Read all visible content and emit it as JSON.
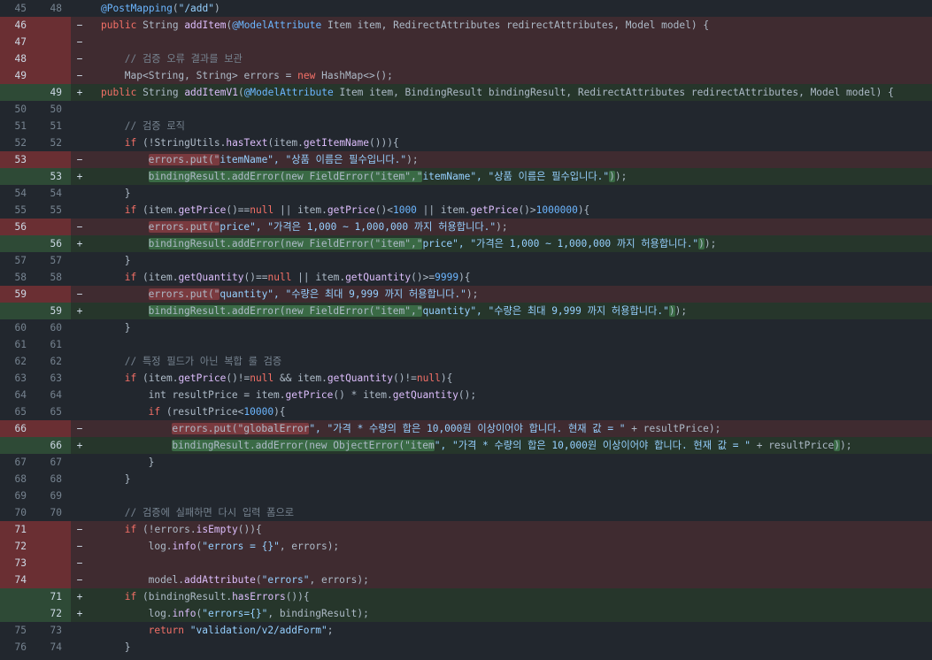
{
  "colors": {
    "background": "#22272e",
    "deleted_line": "#3f2b30",
    "deleted_gutter": "#6a2f33",
    "added_line": "#26362b",
    "added_gutter": "#2e4a36",
    "keyword": "#f47067",
    "string": "#96d0ff",
    "function": "#dcbdfb"
  },
  "lines": [
    {
      "type": "ctx",
      "old": "45",
      "new": "48",
      "marker": "",
      "indent": 0,
      "tokens": [
        [
          "ann",
          "@PostMapping"
        ],
        [
          "plain",
          "("
        ],
        [
          "str",
          "\"/add\""
        ],
        [
          "plain",
          ")"
        ]
      ]
    },
    {
      "type": "del",
      "old": "46",
      "new": "",
      "marker": "−",
      "indent": 0,
      "tokens": [
        [
          "kw",
          "public"
        ],
        [
          "plain",
          " String "
        ],
        [
          "fn",
          "addItem"
        ],
        [
          "plain",
          "("
        ],
        [
          "ann",
          "@ModelAttribute"
        ],
        [
          "plain",
          " Item item, RedirectAttributes redirectAttributes, Model model) {"
        ]
      ]
    },
    {
      "type": "del",
      "old": "47",
      "new": "",
      "marker": "−",
      "indent": 0,
      "tokens": []
    },
    {
      "type": "del",
      "old": "48",
      "new": "",
      "marker": "−",
      "indent": 4,
      "tokens": [
        [
          "cmt",
          "// 검증 오류 결과를 보관"
        ]
      ]
    },
    {
      "type": "del",
      "old": "49",
      "new": "",
      "marker": "−",
      "indent": 4,
      "tokens": [
        [
          "plain",
          "Map<String, String> errors = "
        ],
        [
          "kw",
          "new"
        ],
        [
          "plain",
          " HashMap<>();"
        ]
      ]
    },
    {
      "type": "add",
      "old": "",
      "new": "49",
      "marker": "+",
      "indent": 0,
      "tokens": [
        [
          "kw",
          "public"
        ],
        [
          "plain",
          " String "
        ],
        [
          "fn",
          "addItemV1"
        ],
        [
          "plain",
          "("
        ],
        [
          "ann",
          "@ModelAttribute"
        ],
        [
          "plain",
          " Item item, BindingResult bindingResult, RedirectAttributes redirectAttributes, Model model) {"
        ]
      ]
    },
    {
      "type": "ctx",
      "old": "50",
      "new": "50",
      "marker": "",
      "indent": 0,
      "tokens": []
    },
    {
      "type": "ctx",
      "old": "51",
      "new": "51",
      "marker": "",
      "indent": 4,
      "tokens": [
        [
          "cmt",
          "// 검증 로직"
        ]
      ]
    },
    {
      "type": "ctx",
      "old": "52",
      "new": "52",
      "marker": "",
      "indent": 4,
      "tokens": [
        [
          "kw",
          "if"
        ],
        [
          "plain",
          " (!StringUtils."
        ],
        [
          "fn",
          "hasText"
        ],
        [
          "plain",
          "(item."
        ],
        [
          "fn",
          "getItemName"
        ],
        [
          "plain",
          "())){"
        ]
      ]
    },
    {
      "type": "del",
      "old": "53",
      "new": "",
      "marker": "−",
      "indent": 8,
      "tokens": [
        [
          "hl-del",
          "errors.put(\""
        ],
        [
          "str",
          "itemName\", \"상품 이름은 필수입니다.\""
        ],
        [
          "plain",
          ");"
        ]
      ]
    },
    {
      "type": "add",
      "old": "",
      "new": "53",
      "marker": "+",
      "indent": 8,
      "tokens": [
        [
          "hl-add",
          "bindingResult.addError(new FieldError(\"item\",\""
        ],
        [
          "str",
          "itemName\", \"상품 이름은 필수입니다.\""
        ],
        [
          "hl-add",
          ")"
        ],
        [
          "plain",
          ");"
        ]
      ]
    },
    {
      "type": "ctx",
      "old": "54",
      "new": "54",
      "marker": "",
      "indent": 4,
      "tokens": [
        [
          "plain",
          "}"
        ]
      ]
    },
    {
      "type": "ctx",
      "old": "55",
      "new": "55",
      "marker": "",
      "indent": 4,
      "tokens": [
        [
          "kw",
          "if"
        ],
        [
          "plain",
          " (item."
        ],
        [
          "fn",
          "getPrice"
        ],
        [
          "plain",
          "()=="
        ],
        [
          "kw",
          "null"
        ],
        [
          "plain",
          " || item."
        ],
        [
          "fn",
          "getPrice"
        ],
        [
          "plain",
          "()<"
        ],
        [
          "num",
          "1000"
        ],
        [
          "plain",
          " || item."
        ],
        [
          "fn",
          "getPrice"
        ],
        [
          "plain",
          "()>"
        ],
        [
          "num",
          "1000000"
        ],
        [
          "plain",
          "){"
        ]
      ]
    },
    {
      "type": "del",
      "old": "56",
      "new": "",
      "marker": "−",
      "indent": 8,
      "tokens": [
        [
          "hl-del",
          "errors.put(\""
        ],
        [
          "str",
          "price\", \"가격은 1,000 ~ 1,000,000 까지 허용합니다.\""
        ],
        [
          "plain",
          ");"
        ]
      ]
    },
    {
      "type": "add",
      "old": "",
      "new": "56",
      "marker": "+",
      "indent": 8,
      "tokens": [
        [
          "hl-add",
          "bindingResult.addError(new FieldError(\"item\",\""
        ],
        [
          "str",
          "price\", \"가격은 1,000 ~ 1,000,000 까지 허용합니다.\""
        ],
        [
          "hl-add",
          ")"
        ],
        [
          "plain",
          ");"
        ]
      ]
    },
    {
      "type": "ctx",
      "old": "57",
      "new": "57",
      "marker": "",
      "indent": 4,
      "tokens": [
        [
          "plain",
          "}"
        ]
      ]
    },
    {
      "type": "ctx",
      "old": "58",
      "new": "58",
      "marker": "",
      "indent": 4,
      "tokens": [
        [
          "kw",
          "if"
        ],
        [
          "plain",
          " (item."
        ],
        [
          "fn",
          "getQuantity"
        ],
        [
          "plain",
          "()=="
        ],
        [
          "kw",
          "null"
        ],
        [
          "plain",
          " || item."
        ],
        [
          "fn",
          "getQuantity"
        ],
        [
          "plain",
          "()>="
        ],
        [
          "num",
          "9999"
        ],
        [
          "plain",
          "){"
        ]
      ]
    },
    {
      "type": "del",
      "old": "59",
      "new": "",
      "marker": "−",
      "indent": 8,
      "tokens": [
        [
          "hl-del",
          "errors.put(\""
        ],
        [
          "str",
          "quantity\", \"수량은 최대 9,999 까지 허용합니다.\""
        ],
        [
          "plain",
          ");"
        ]
      ]
    },
    {
      "type": "add",
      "old": "",
      "new": "59",
      "marker": "+",
      "indent": 8,
      "tokens": [
        [
          "hl-add",
          "bindingResult.addError(new FieldError(\"item\",\""
        ],
        [
          "str",
          "quantity\", \"수량은 최대 9,999 까지 허용합니다.\""
        ],
        [
          "hl-add",
          ")"
        ],
        [
          "plain",
          ");"
        ]
      ]
    },
    {
      "type": "ctx",
      "old": "60",
      "new": "60",
      "marker": "",
      "indent": 4,
      "tokens": [
        [
          "plain",
          "}"
        ]
      ]
    },
    {
      "type": "ctx",
      "old": "61",
      "new": "61",
      "marker": "",
      "indent": 0,
      "tokens": []
    },
    {
      "type": "ctx",
      "old": "62",
      "new": "62",
      "marker": "",
      "indent": 4,
      "tokens": [
        [
          "cmt",
          "// 특정 필드가 아닌 복합 룰 검증"
        ]
      ]
    },
    {
      "type": "ctx",
      "old": "63",
      "new": "63",
      "marker": "",
      "indent": 4,
      "tokens": [
        [
          "kw",
          "if"
        ],
        [
          "plain",
          " (item."
        ],
        [
          "fn",
          "getPrice"
        ],
        [
          "plain",
          "()!="
        ],
        [
          "kw",
          "null"
        ],
        [
          "plain",
          " && item."
        ],
        [
          "fn",
          "getQuantity"
        ],
        [
          "plain",
          "()!="
        ],
        [
          "kw",
          "null"
        ],
        [
          "plain",
          "){"
        ]
      ]
    },
    {
      "type": "ctx",
      "old": "64",
      "new": "64",
      "marker": "",
      "indent": 8,
      "tokens": [
        [
          "plain",
          "int resultPrice = item."
        ],
        [
          "fn",
          "getPrice"
        ],
        [
          "plain",
          "() * item."
        ],
        [
          "fn",
          "getQuantity"
        ],
        [
          "plain",
          "();"
        ]
      ]
    },
    {
      "type": "ctx",
      "old": "65",
      "new": "65",
      "marker": "",
      "indent": 8,
      "tokens": [
        [
          "kw",
          "if"
        ],
        [
          "plain",
          " (resultPrice<"
        ],
        [
          "num",
          "10000"
        ],
        [
          "plain",
          "){"
        ]
      ]
    },
    {
      "type": "del",
      "old": "66",
      "new": "",
      "marker": "−",
      "indent": 12,
      "tokens": [
        [
          "hl-del",
          "errors.put(\"globalError"
        ],
        [
          "str",
          "\", \"가격 * 수량의 합은 10,000원 이상이어야 합니다. 현재 값 = \""
        ],
        [
          "plain",
          " + resultPrice);"
        ]
      ]
    },
    {
      "type": "add",
      "old": "",
      "new": "66",
      "marker": "+",
      "indent": 12,
      "tokens": [
        [
          "hl-add",
          "bindingResult.addError(new ObjectError(\"item"
        ],
        [
          "str",
          "\", \"가격 * 수량의 합은 10,000원 이상이어야 합니다. 현재 값 = \""
        ],
        [
          "plain",
          " + resultPrice"
        ],
        [
          "hl-add",
          ")"
        ],
        [
          "plain",
          ");"
        ]
      ]
    },
    {
      "type": "ctx",
      "old": "67",
      "new": "67",
      "marker": "",
      "indent": 8,
      "tokens": [
        [
          "plain",
          "}"
        ]
      ]
    },
    {
      "type": "ctx",
      "old": "68",
      "new": "68",
      "marker": "",
      "indent": 4,
      "tokens": [
        [
          "plain",
          "}"
        ]
      ]
    },
    {
      "type": "ctx",
      "old": "69",
      "new": "69",
      "marker": "",
      "indent": 0,
      "tokens": []
    },
    {
      "type": "ctx",
      "old": "70",
      "new": "70",
      "marker": "",
      "indent": 4,
      "tokens": [
        [
          "cmt",
          "// 검증에 실패하면 다시 입력 폼으로"
        ]
      ]
    },
    {
      "type": "del",
      "old": "71",
      "new": "",
      "marker": "−",
      "indent": 4,
      "tokens": [
        [
          "kw",
          "if"
        ],
        [
          "plain",
          " (!errors."
        ],
        [
          "fn",
          "isEmpty"
        ],
        [
          "plain",
          "()){"
        ]
      ]
    },
    {
      "type": "del",
      "old": "72",
      "new": "",
      "marker": "−",
      "indent": 8,
      "tokens": [
        [
          "plain",
          "log."
        ],
        [
          "fn",
          "info"
        ],
        [
          "plain",
          "("
        ],
        [
          "str",
          "\"errors = {}\""
        ],
        [
          "plain",
          ", errors);"
        ]
      ]
    },
    {
      "type": "del",
      "old": "73",
      "new": "",
      "marker": "−",
      "indent": 0,
      "tokens": []
    },
    {
      "type": "del",
      "old": "74",
      "new": "",
      "marker": "−",
      "indent": 8,
      "tokens": [
        [
          "plain",
          "model."
        ],
        [
          "fn",
          "addAttribute"
        ],
        [
          "plain",
          "("
        ],
        [
          "str",
          "\"errors\""
        ],
        [
          "plain",
          ", errors);"
        ]
      ]
    },
    {
      "type": "add",
      "old": "",
      "new": "71",
      "marker": "+",
      "indent": 4,
      "tokens": [
        [
          "kw",
          "if"
        ],
        [
          "plain",
          " (bindingResult."
        ],
        [
          "fn",
          "hasErrors"
        ],
        [
          "plain",
          "()){"
        ]
      ]
    },
    {
      "type": "add",
      "old": "",
      "new": "72",
      "marker": "+",
      "indent": 8,
      "tokens": [
        [
          "plain",
          "log."
        ],
        [
          "fn",
          "info"
        ],
        [
          "plain",
          "("
        ],
        [
          "str",
          "\"errors={}\""
        ],
        [
          "plain",
          ", bindingResult);"
        ]
      ]
    },
    {
      "type": "ctx",
      "old": "75",
      "new": "73",
      "marker": "",
      "indent": 8,
      "tokens": [
        [
          "kw",
          "return"
        ],
        [
          "plain",
          " "
        ],
        [
          "str",
          "\"validation/v2/addForm\""
        ],
        [
          "plain",
          ";"
        ]
      ]
    },
    {
      "type": "ctx",
      "old": "76",
      "new": "74",
      "marker": "",
      "indent": 4,
      "tokens": [
        [
          "plain",
          "}"
        ]
      ]
    }
  ]
}
